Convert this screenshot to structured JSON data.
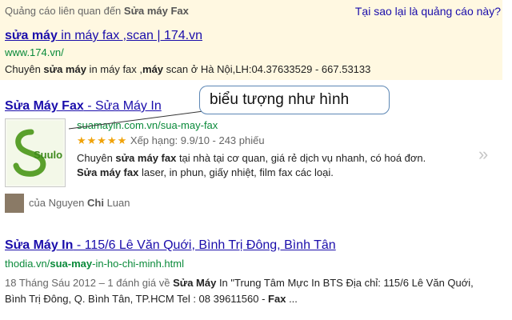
{
  "ad": {
    "header_prefix": "Quảng cáo liên quan đến",
    "header_query": "Sửa máy Fax",
    "why_link": "Tại sao lại là quảng cáo này?",
    "title_bold": "sửa máy",
    "title_rest": " in máy fax ,scan | 174.vn",
    "url": "www.174.vn/",
    "desc_1": "Chuyên ",
    "desc_bold_1": "sửa máy",
    "desc_2": " in máy fax ,",
    "desc_bold_2": "máy",
    "desc_3": " scan ở Hà Nội,LH:04.37633529 - 667.53133"
  },
  "result1": {
    "title_bold": "Sửa Máy Fax",
    "title_rest": " - Sửa Máy In",
    "url": "suamayin.com.vn/sua-may-fax",
    "stars": "★★★★★",
    "rating_text": " Xếp hạng: 9.9/10 - 243 phiếu",
    "desc_1": "Chuyên ",
    "desc_bold_1": "sửa máy fax",
    "desc_2": " tại nhà tại cơ quan, giá rẻ dịch vụ nhanh, có hoá đơn. ",
    "desc_bold_2": "Sửa máy fax",
    "desc_3": " laser, in phun, giấy nhiệt, film fax các loại.",
    "more_glyph": "»",
    "author_prefix": "của Nguyen ",
    "author_bold": "Chi",
    "author_rest": " Luan",
    "logo_text": "Suulong"
  },
  "callout": {
    "text": "biểu tượng như hình"
  },
  "result2": {
    "title_bold_1": "Sửa Máy In",
    "title_rest": " - 115/6 Lê Văn Quới, Bình Trị Đông, Bình Tân",
    "url_1": "thodia.vn/",
    "url_bold": "sua-may",
    "url_2": "-in-ho-chi-minh.html",
    "desc_date": "18 Tháng Sáu 2012 – 1 đánh giá về ",
    "desc_bold_1": "Sửa Máy",
    "desc_2": " In \"Trung Tâm Mực In BTS Địa chỉ: 115/6 Lê Văn Quới, Bình Trị Đông, Q. Bình Tân, TP.HCM Tel : 08 39611560 - ",
    "desc_bold_2": "Fax",
    "desc_3": " ..."
  },
  "colors": {
    "link": "#1a0dab",
    "url_green": "#0a8a3a",
    "ad_bg": "#fff8e1",
    "star": "#f0a30a",
    "callout_border": "#5c86b4"
  }
}
